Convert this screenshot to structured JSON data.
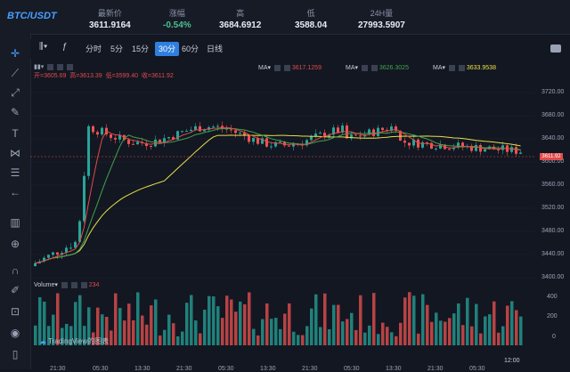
{
  "ticker": {
    "pair": "BTC/USDT",
    "stats": [
      {
        "label": "最新价",
        "value": "3611.9164",
        "class": ""
      },
      {
        "label": "涨幅",
        "value": "-0.54%",
        "class": "neg"
      },
      {
        "label": "高",
        "value": "3684.6912",
        "class": ""
      },
      {
        "label": "低",
        "value": "3588.04",
        "class": ""
      },
      {
        "label": "24H量",
        "value": "27993.5907",
        "class": ""
      }
    ]
  },
  "toolbar": {
    "intervals": [
      "分时",
      "5分",
      "15分",
      "30分",
      "60分",
      "日线"
    ],
    "active_interval": "30分"
  },
  "legend": {
    "open_label": "开=3605.69",
    "high_label": "高=3613.39",
    "low_label": "低=3599.40",
    "close_label": "收=3611.92",
    "ma1_label": "MA▾",
    "ma1_value": "3617.1259",
    "ma2_label": "MA▾",
    "ma2_value": "3626.3025",
    "ma3_label": "MA▾",
    "ma3_value": "3633.9538",
    "volume_label": "Volume▾",
    "volume_value": "234"
  },
  "price_axis": [
    "3720.00",
    "3680.00",
    "3640.00",
    "3600.00",
    "3560.00",
    "3520.00",
    "3480.00",
    "3440.00",
    "3400.00"
  ],
  "current_price_tag": "3611.92",
  "volume_axis": [
    "400",
    "200",
    "0"
  ],
  "time_axis": [
    "21:30",
    "05:30",
    "13:30",
    "21:30",
    "05:30",
    "13:30",
    "21:30",
    "05:30",
    "13:30",
    "21:30",
    "05:30",
    "13:30",
    "21:30"
  ],
  "clock": "12:00",
  "tradingview": "TradingView的图表",
  "colors": {
    "up": "#26a69a",
    "down": "#ef5350",
    "ma1": "#e04b4b",
    "ma2": "#3fa34d",
    "ma3": "#e8e04a"
  }
}
